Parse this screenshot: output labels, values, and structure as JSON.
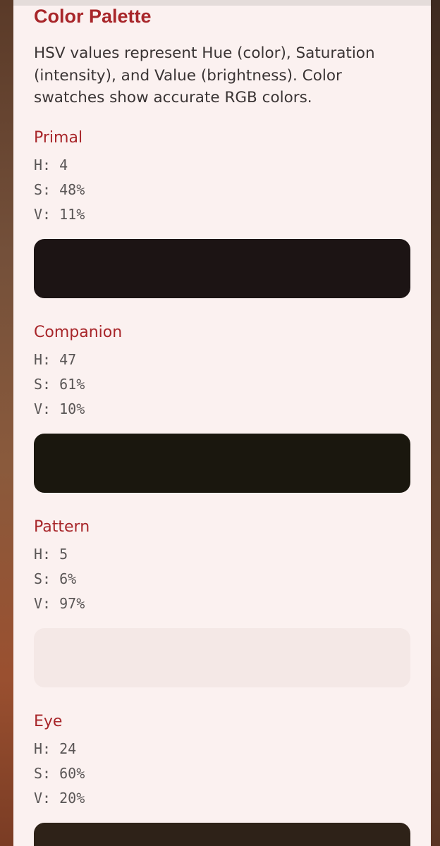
{
  "palette": {
    "title": "Color Palette",
    "description": "HSV values represent Hue (color), Saturation (intensity), and Value (brightness). Color swatches show accurate RGB colors.",
    "sections": [
      {
        "name": "Primal",
        "h": "H: 4",
        "s": "S: 48%",
        "v": "V: 11%",
        "color": "#1c1414"
      },
      {
        "name": "Companion",
        "h": "H: 47",
        "s": "S: 61%",
        "v": "V: 10%",
        "color": "#1a170e"
      },
      {
        "name": "Pattern",
        "h": "H: 5",
        "s": "S: 6%",
        "v": "V: 97%",
        "color": "#f4e8e6"
      },
      {
        "name": "Eye",
        "h": "H: 24",
        "s": "S: 60%",
        "v": "V: 20%",
        "color": "#2e2218"
      }
    ]
  }
}
